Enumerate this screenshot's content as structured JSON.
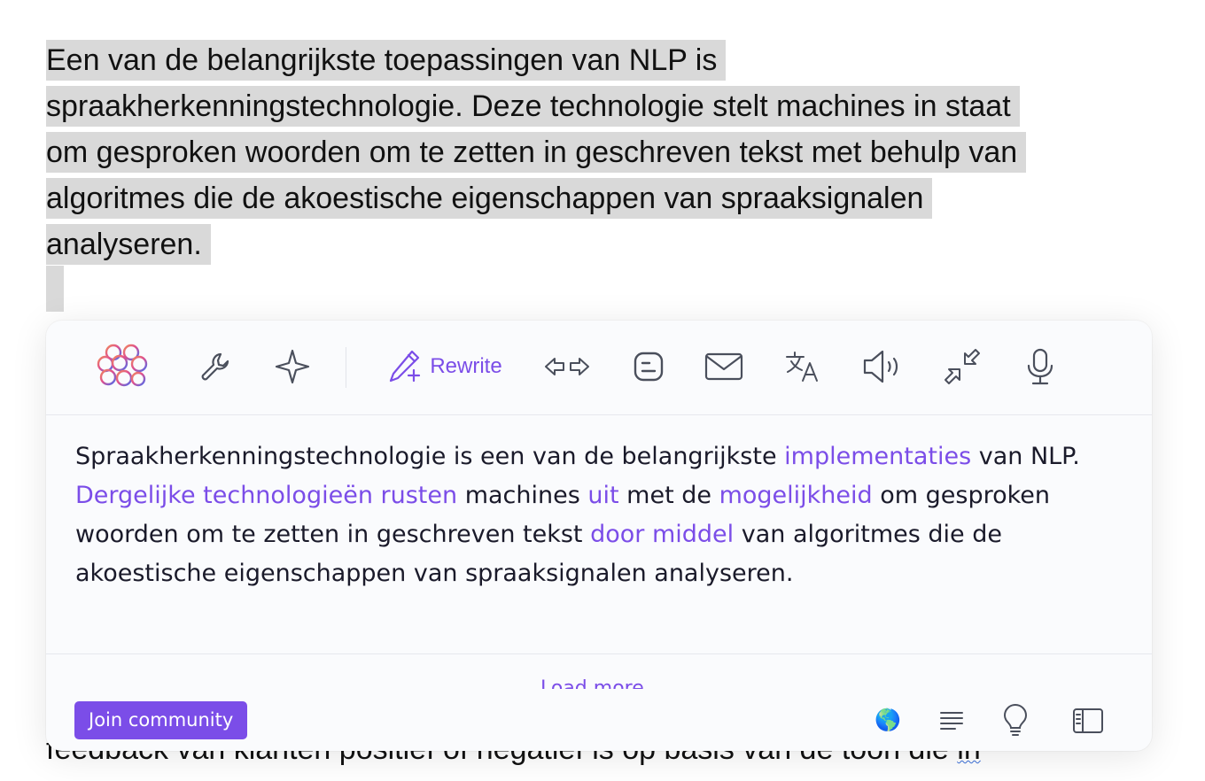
{
  "document": {
    "selected_paragraph_lines": [
      "Een van de belangrijkste toepassingen van NLP is",
      "spraakherkenningstechnologie. Deze technologie stelt machines in staat",
      "om gesproken woorden om te zetten in geschreven tekst met behulp van",
      "algoritmes die de akoestische eigenschappen van spraaksignalen",
      "analyseren."
    ],
    "bottom_line_text": "feedback van klanten positief of negatief is op basis van de toon die",
    "bottom_line_underlined": "in"
  },
  "toolbar": {
    "logo_icon": "brain-logo-icon",
    "rewrite_label": "Rewrite",
    "icons": [
      "wrench-icon",
      "sparkle-icon",
      "rewrite-pencil-icon",
      "expand-shorten-arrows-icon",
      "blog-icon",
      "mail-icon",
      "translate-icon",
      "speaker-icon",
      "collapse-arrows-icon",
      "microphone-icon"
    ]
  },
  "rewrite_result": {
    "segments": [
      {
        "text": "Spraakherkenningstechnologie is een van de belangrijkste ",
        "changed": false
      },
      {
        "text": "implementaties",
        "changed": true
      },
      {
        "text": " van NLP. ",
        "changed": false
      },
      {
        "text": "Dergelijke technologieën rusten",
        "changed": true
      },
      {
        "text": " machines ",
        "changed": false
      },
      {
        "text": "uit",
        "changed": true
      },
      {
        "text": " met de ",
        "changed": false
      },
      {
        "text": "mogelijkheid",
        "changed": true
      },
      {
        "text": " om gesproken woorden om te zetten in geschreven tekst ",
        "changed": false
      },
      {
        "text": "door middel",
        "changed": true
      },
      {
        "text": " van algoritmes die de akoestische eigenschappen van spraaksignalen analyseren.",
        "changed": false
      }
    ]
  },
  "footer": {
    "load_more_label": "Load more",
    "join_label": "Join community",
    "icons": [
      "globe-icon",
      "text-align-icon",
      "lightbulb-icon",
      "sidebar-icon"
    ]
  },
  "colors": {
    "accent": "#7b4de8",
    "selection": "#d9d9d9",
    "icon_gray": "#4a4f5c"
  }
}
